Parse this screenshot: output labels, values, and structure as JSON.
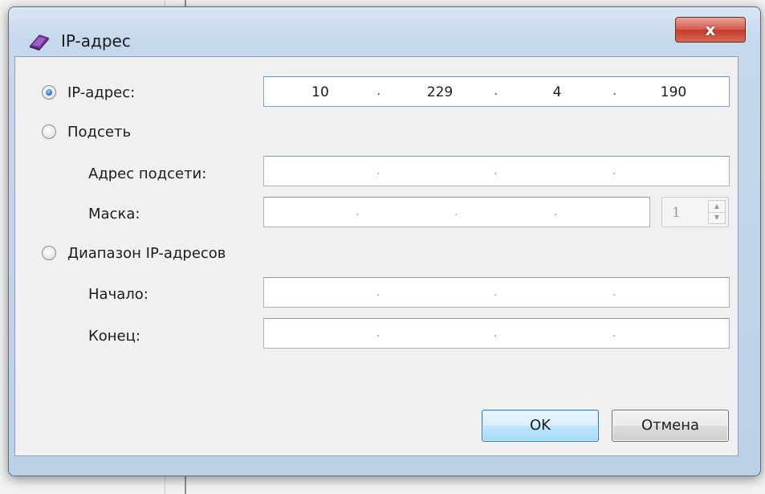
{
  "window": {
    "title": "IP-адрес",
    "close_glyph": "x",
    "icon": "network-card-icon"
  },
  "mode_ip": {
    "label": "IP-адрес:",
    "selected": true,
    "octets": [
      "10",
      "229",
      "4",
      "190"
    ]
  },
  "mode_subnet": {
    "label": "Подсеть",
    "selected": false,
    "address_label": "Адрес подсети:",
    "mask_label": "Маска:",
    "mask_prefix": "1"
  },
  "mode_range": {
    "label": "Диапазон IP-адресов",
    "selected": false,
    "start_label": "Начало:",
    "end_label": "Конец:"
  },
  "buttons": {
    "ok": "OK",
    "cancel": "Отмена"
  },
  "ip_separator": ".",
  "colors": {
    "accent": "#2b77d3",
    "close_button": "#c43b2c",
    "ok_border": "#3c7fb1"
  }
}
